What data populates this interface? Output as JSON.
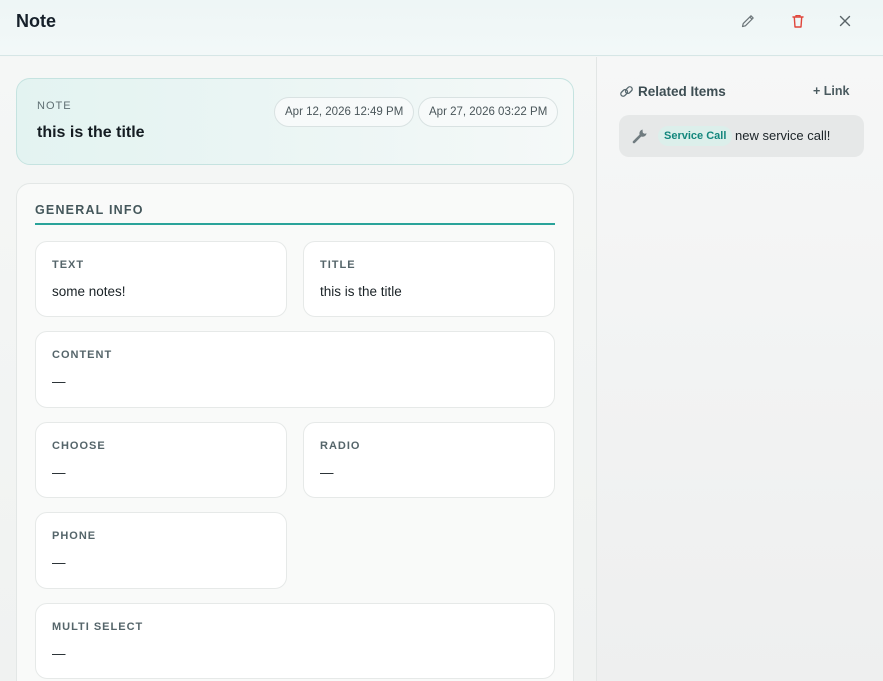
{
  "header": {
    "title": "Note",
    "edit_icon": "pencil-icon",
    "delete_icon": "trash-icon",
    "close_icon": "close-icon"
  },
  "note_card": {
    "kicker": "NOTE",
    "title": "this is the title",
    "created": "Apr 12, 2026 12:49 PM",
    "updated": "Apr 27, 2026 03:22 PM"
  },
  "general_info": {
    "section_title": "GENERAL INFO",
    "fields": {
      "text": {
        "label": "TEXT",
        "value": "some notes!"
      },
      "title": {
        "label": "TITLE",
        "value": "this is the title"
      },
      "content": {
        "label": "CONTENT",
        "value": "—"
      },
      "choose": {
        "label": "CHOOSE",
        "value": "—"
      },
      "radio": {
        "label": "RADIO",
        "value": "—"
      },
      "phone": {
        "label": "PHONE",
        "value": "—"
      },
      "multi_select": {
        "label": "MULTI SELECT",
        "value": "—"
      }
    }
  },
  "related": {
    "title": "Related Items",
    "title_icon": "link-icon",
    "link_label": "+ Link",
    "items": [
      {
        "icon": "wrench-icon",
        "badge": "Service Call",
        "text": "new service call!"
      }
    ]
  },
  "colors": {
    "accent": "#2aa39a",
    "badge_bg": "#dcefeb",
    "badge_text": "#13877d",
    "delete_red": "#e0453a"
  }
}
